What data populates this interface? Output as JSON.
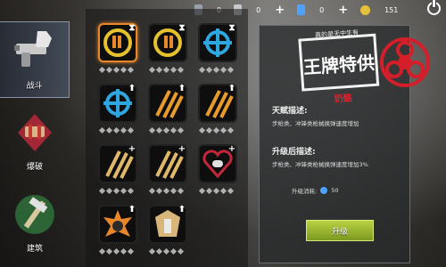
{
  "topbar": {
    "resources": [
      {
        "icon": "ammo-card-icon",
        "value": "0",
        "color": "#9aa0a8"
      },
      {
        "icon": "document-card-icon",
        "value": "0",
        "color": "#c7c9cc"
      },
      {
        "icon": "gem-card-icon",
        "value": "0",
        "color": "#4da3ff"
      },
      {
        "icon": "gold-coin-icon",
        "value": "151",
        "color": "#e7c13a"
      }
    ],
    "plus": "+"
  },
  "sidebar": {
    "items": [
      {
        "label": "战斗",
        "icon": "pistol-fist-icon"
      },
      {
        "label": "爆破",
        "icon": "explosive-hand-icon"
      },
      {
        "label": "建筑",
        "icon": "hammer-build-icon"
      }
    ]
  },
  "panel": {
    "talent_title": "天赋描述:",
    "talent_desc": "步枪类、冲锋类枪械换弹速度增加",
    "after_title": "升级后描述:",
    "after_desc": "步枪类、冲锋类枪械换弹速度增加3%",
    "cost_label": "升级消耗:",
    "cost_value": "50",
    "upgrade_label": "升级"
  },
  "stamp": {
    "top_text": "真的是无中生有",
    "main_text": "王牌特供",
    "bottom_text": "奶酪"
  },
  "colors": {
    "accent": "#e8862a",
    "upgrade": "#9bb52e"
  }
}
